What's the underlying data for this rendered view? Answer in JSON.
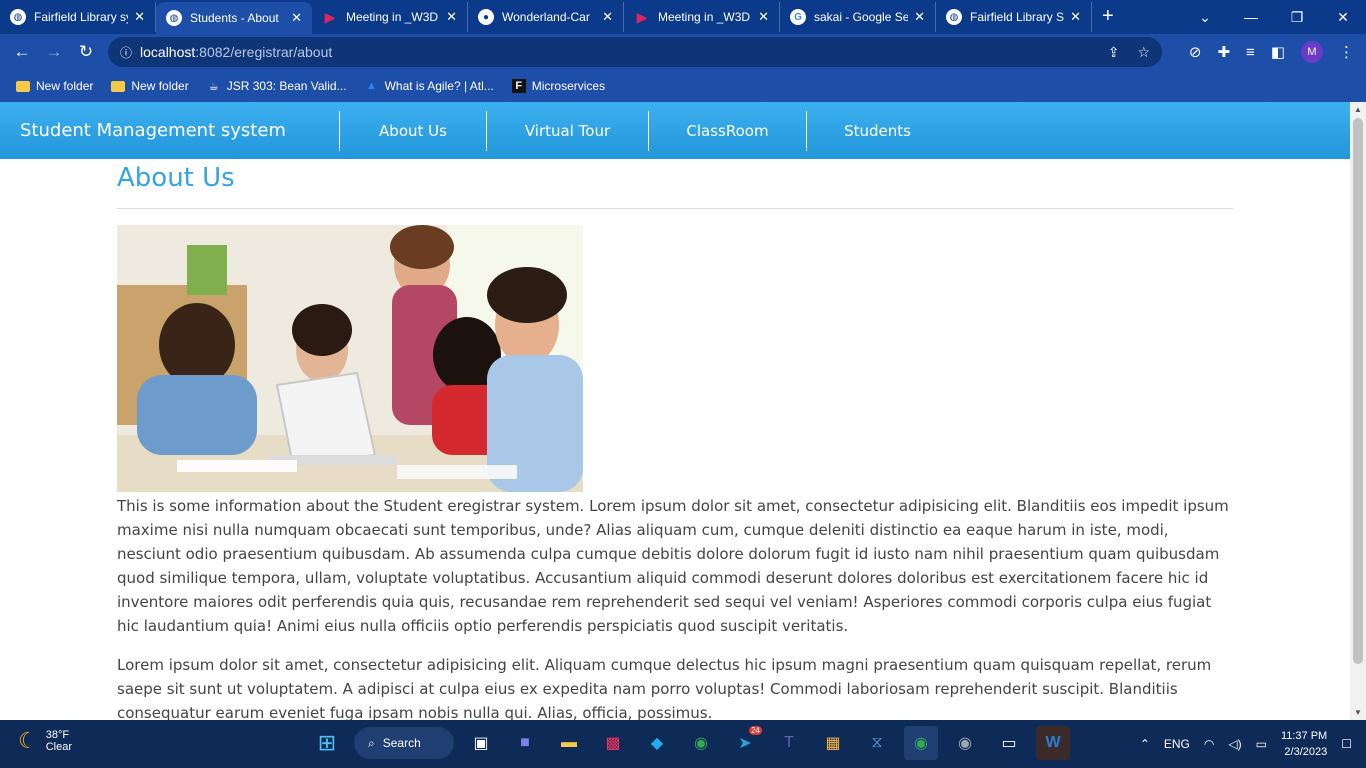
{
  "browser": {
    "tabs": [
      {
        "label": "Fairfield Library sy",
        "icon": "globe-icon",
        "active": false
      },
      {
        "label": "Students - About",
        "icon": "globe-icon",
        "active": true
      },
      {
        "label": "Meeting in _W3D",
        "icon": "play-icon",
        "active": false
      },
      {
        "label": "Wonderland-Car",
        "icon": "github-icon",
        "active": false
      },
      {
        "label": "Meeting in _W3D",
        "icon": "play-icon",
        "active": false
      },
      {
        "label": "sakai - Google Se",
        "icon": "google-icon",
        "active": false
      },
      {
        "label": "Fairfield Library S",
        "icon": "globe-icon",
        "active": false
      }
    ],
    "new_tab": "+",
    "url_host": "localhost",
    "url_path": ":8082/eregistrar/about",
    "profile_initial": "M",
    "bookmarks": [
      {
        "label": "New folder",
        "icon": "folder-icon"
      },
      {
        "label": "New folder",
        "icon": "folder-icon"
      },
      {
        "label": "JSR 303: Bean Valid...",
        "icon": "java-icon"
      },
      {
        "label": "What is Agile? | Atl...",
        "icon": "atlassian-icon"
      },
      {
        "label": "Microservices",
        "icon": "f-icon"
      }
    ]
  },
  "site": {
    "brand": "Student Management system",
    "nav": [
      {
        "label": "About Us"
      },
      {
        "label": "Virtual Tour"
      },
      {
        "label": "ClassRoom"
      },
      {
        "label": "Students"
      }
    ],
    "accent": "#36a3e4",
    "page_title": "About Us",
    "paragraphs": [
      "This is some information about the Student eregistrar system. Lorem ipsum dolor sit amet, consectetur adipisicing elit. Blanditiis eos impedit ipsum maxime nisi nulla numquam obcaecati sunt temporibus, unde? Alias aliquam cum, cumque deleniti distinctio ea eaque harum in iste, modi, nesciunt odio praesentium quibusdam. Ab assumenda culpa cumque debitis dolore dolorum fugit id iusto nam nihil praesentium quam quibusdam quod similique tempora, ullam, voluptate voluptatibus. Accusantium aliquid commodi deserunt dolores doloribus est exercitationem facere hic id inventore maiores odit perferendis quia quis, recusandae rem reprehenderit sed sequi vel veniam! Asperiores commodi corporis culpa eius fugiat hic laudantium quia! Animi eius nulla officiis optio perferendis perspiciatis quod suscipit veritatis.",
      "Lorem ipsum dolor sit amet, consectetur adipisicing elit. Aliquam cumque delectus hic ipsum magni praesentium quam quisquam repellat, rerum saepe sit sunt ut voluptatem. A adipisci at culpa eius ex expedita nam porro voluptas! Commodi laboriosam reprehenderit suscipit. Blanditiis consequatur earum eveniet fuga ipsam nobis nulla qui. Alias, officia, possimus."
    ]
  },
  "taskbar": {
    "temperature": "38°F",
    "condition": "Clear",
    "search_label": "Search",
    "language": "ENG",
    "time": "11:37 PM",
    "date": "2/3/2023",
    "telegram_badge": "24"
  }
}
